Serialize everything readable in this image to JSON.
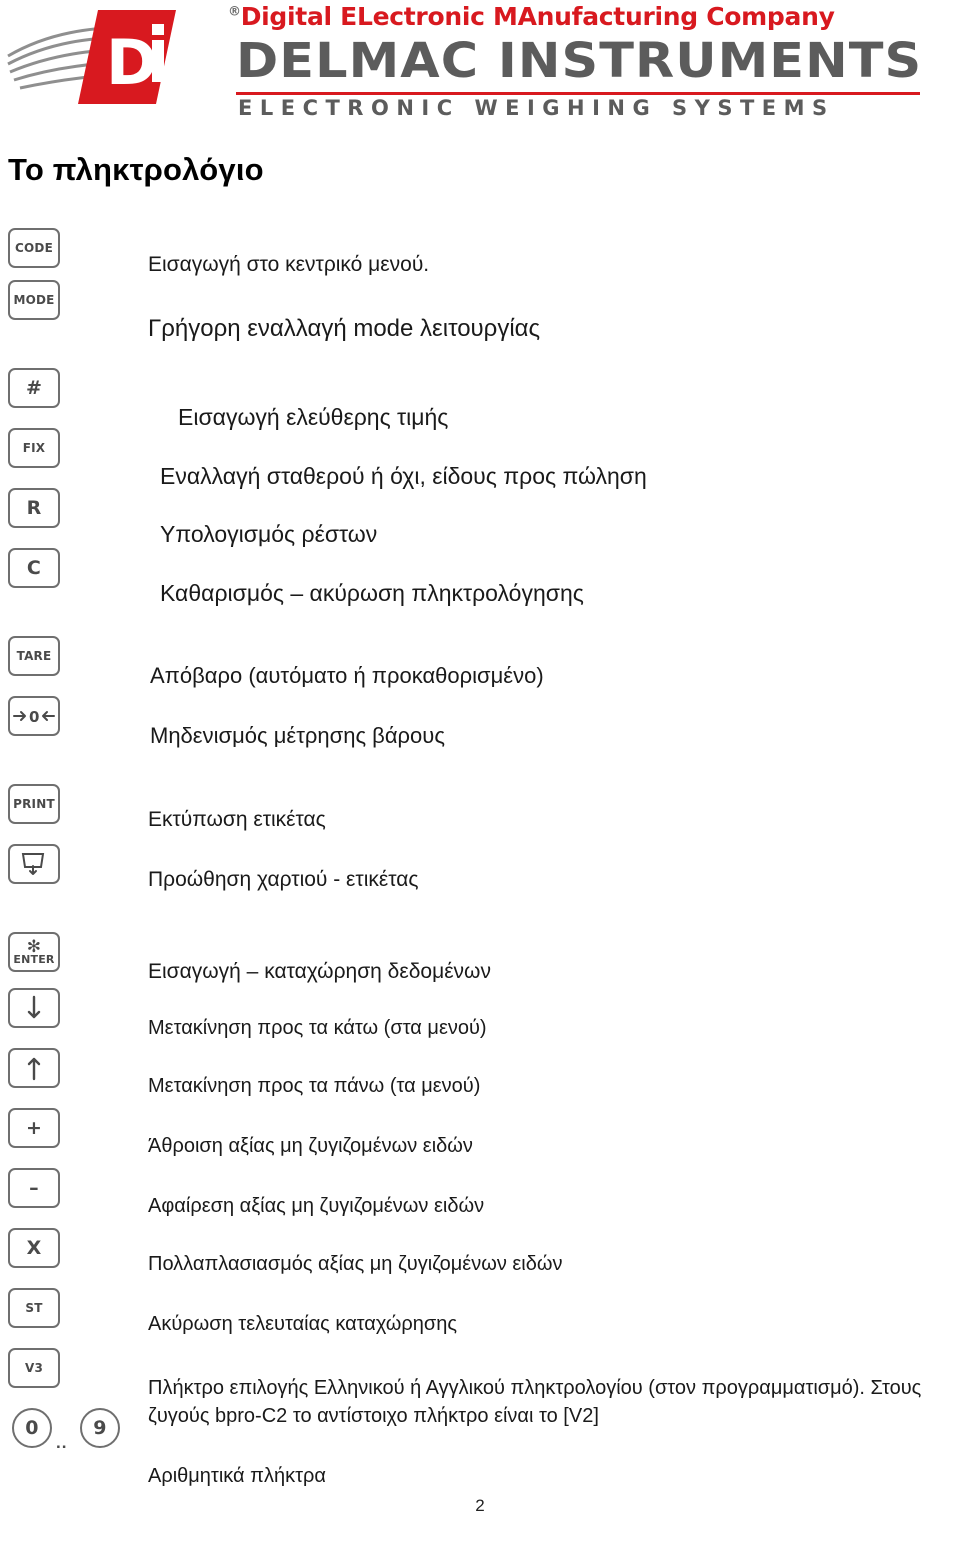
{
  "header": {
    "brand_top_prefix": "Digital ",
    "brand_top": "Digital ELectronic MAnufacturing Company",
    "registered_mark": "®",
    "brand_main": "DELMAC INSTRUMENTS",
    "brand_sub": "ELECTRONIC WEIGHING SYSTEMS",
    "logo_letters": "Di"
  },
  "page": {
    "title": "Το πληκτρολόγιο",
    "number": "2"
  },
  "keys": [
    {
      "id": "code",
      "label": "CODE",
      "type": "text"
    },
    {
      "id": "mode",
      "label": "MODE",
      "type": "text"
    },
    {
      "id": "hash",
      "label": "#",
      "type": "text"
    },
    {
      "id": "fix",
      "label": "FIX",
      "type": "text"
    },
    {
      "id": "r",
      "label": "R",
      "type": "text"
    },
    {
      "id": "c",
      "label": "C",
      "type": "text"
    },
    {
      "id": "tare",
      "label": "TARE",
      "type": "text"
    },
    {
      "id": "zero",
      "label": "0",
      "type": "zero-arrows"
    },
    {
      "id": "print",
      "label": "PRINT",
      "type": "text"
    },
    {
      "id": "feed",
      "label": "",
      "type": "feed-icon"
    },
    {
      "id": "enter",
      "label": "ENTER",
      "star": "✻",
      "type": "enter"
    },
    {
      "id": "down",
      "label": "↓",
      "type": "arrow-down"
    },
    {
      "id": "up",
      "label": "↑",
      "type": "arrow-up"
    },
    {
      "id": "plus",
      "label": "+",
      "type": "text"
    },
    {
      "id": "minus",
      "label": "–",
      "type": "text"
    },
    {
      "id": "x",
      "label": "X",
      "type": "text"
    },
    {
      "id": "st",
      "label": "ST",
      "type": "text"
    },
    {
      "id": "v3",
      "label": "V3",
      "type": "text"
    },
    {
      "id": "num0",
      "label": "0",
      "type": "round"
    },
    {
      "id": "dots",
      "label": "..",
      "type": "dots"
    },
    {
      "id": "num9",
      "label": "9",
      "type": "round"
    }
  ],
  "descriptions": [
    {
      "id": "desc-code",
      "text": "Εισαγωγή στο κεντρικό μενού."
    },
    {
      "id": "desc-mode",
      "text": "Γρήγορη εναλλαγή mode λειτουργίας"
    },
    {
      "id": "desc-hash",
      "text": "Εισαγωγή ελεύθερης τιμής"
    },
    {
      "id": "desc-fix",
      "text": "Εναλλαγή σταθερού ή όχι, είδους προς πώληση"
    },
    {
      "id": "desc-r",
      "text": "Υπολογισμός ρέστων"
    },
    {
      "id": "desc-c",
      "text": "Καθαρισμός – ακύρωση πληκτρολόγησης"
    },
    {
      "id": "desc-tare",
      "text": "Απόβαρο (αυτόματο ή προκαθορισμένο)"
    },
    {
      "id": "desc-zero",
      "text": "Μηδενισμός μέτρησης βάρους"
    },
    {
      "id": "desc-print",
      "text": "Εκτύπωση ετικέτας"
    },
    {
      "id": "desc-feed",
      "text": "Προώθηση χαρτιού - ετικέτας"
    },
    {
      "id": "desc-enter",
      "text": "Εισαγωγή – καταχώρηση δεδομένων"
    },
    {
      "id": "desc-down",
      "text": "Μετακίνηση προς τα κάτω (στα μενού)"
    },
    {
      "id": "desc-up",
      "text": "Μετακίνηση προς τα πάνω (τα μενού)"
    },
    {
      "id": "desc-plus",
      "text": "Άθροιση αξίας μη ζυγιζομένων ειδών"
    },
    {
      "id": "desc-minus",
      "text": "Αφαίρεση αξίας μη ζυγιζομένων ειδών"
    },
    {
      "id": "desc-x",
      "text": "Πολλαπλασιασμός αξίας μη ζυγιζομένων ειδών"
    },
    {
      "id": "desc-st",
      "text": "Ακύρωση τελευταίας καταχώρησης"
    },
    {
      "id": "desc-v3",
      "text": "Πλήκτρο επιλογής Ελληνικού ή Αγγλικού πληκτρολογίου (στον προγραμματισμό). Στους ζυγούς bpro-C2 το αντίστοιχο πλήκτρο είναι το [V2]"
    },
    {
      "id": "desc-num",
      "text": "Αριθμητικά πλήκτρα"
    }
  ],
  "colors": {
    "brand_red": "#d8191f",
    "brand_gray": "#5c5c5c",
    "key_border": "#6f6f6f"
  }
}
